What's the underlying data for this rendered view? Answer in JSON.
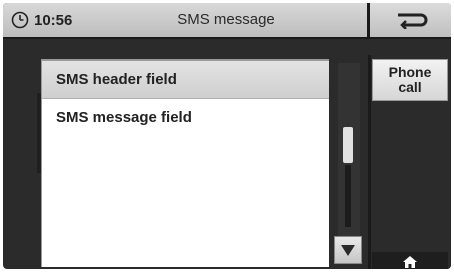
{
  "header": {
    "time": "10:56",
    "title": "SMS message",
    "clock_icon": "clock-icon",
    "back_icon": "back-arrow-icon"
  },
  "list": {
    "items": [
      {
        "label": "SMS header field"
      },
      {
        "label": "SMS message field"
      }
    ]
  },
  "sidebar": {
    "phone_call_line1": "Phone",
    "phone_call_line2": "call",
    "home_icon": "home-icon"
  },
  "scrollbar": {
    "down_icon": "triangle-down-icon"
  }
}
